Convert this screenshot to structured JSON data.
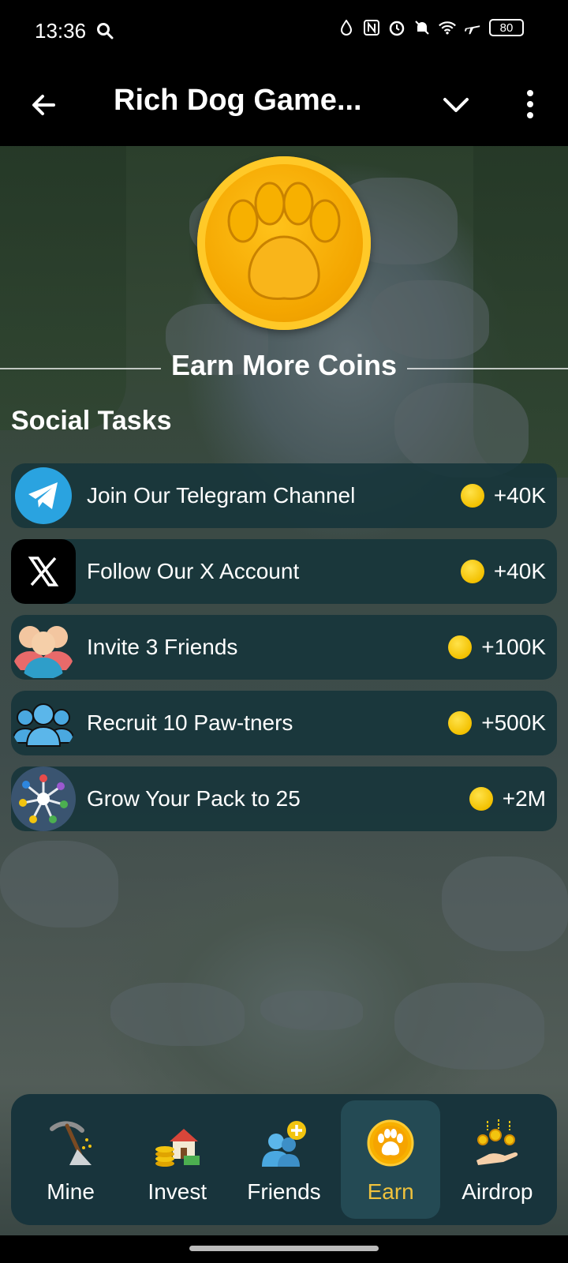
{
  "status_bar": {
    "time": "13:36",
    "battery": "80"
  },
  "app_bar": {
    "title": "Rich Dog Game..."
  },
  "section": {
    "title": "Earn More Coins"
  },
  "social": {
    "title": "Social Tasks",
    "tasks": [
      {
        "icon": "telegram-icon",
        "label": "Join Our Telegram Channel",
        "reward": "+40K"
      },
      {
        "icon": "x-logo-icon",
        "label": "Follow Our X Account",
        "reward": "+40K"
      },
      {
        "icon": "friends-group-icon",
        "label": "Invite 3 Friends",
        "reward": "+100K"
      },
      {
        "icon": "team-icon",
        "label": "Recruit 10 Paw-tners",
        "reward": "+500K"
      },
      {
        "icon": "network-icon",
        "label": "Grow Your Pack to 25",
        "reward": "+2M"
      }
    ]
  },
  "nav": {
    "items": [
      {
        "label": "Mine",
        "icon": "pickaxe-icon",
        "active": false
      },
      {
        "label": "Invest",
        "icon": "house-coins-icon",
        "active": false
      },
      {
        "label": "Friends",
        "icon": "add-friend-icon",
        "active": false
      },
      {
        "label": "Earn",
        "icon": "paw-coin-icon",
        "active": true
      },
      {
        "label": "Airdrop",
        "icon": "airdrop-hand-icon",
        "active": false
      }
    ]
  },
  "colors": {
    "accent_gold": "#f0c23c",
    "card_bg": "#16343a",
    "nav_bg": "#18343c"
  }
}
